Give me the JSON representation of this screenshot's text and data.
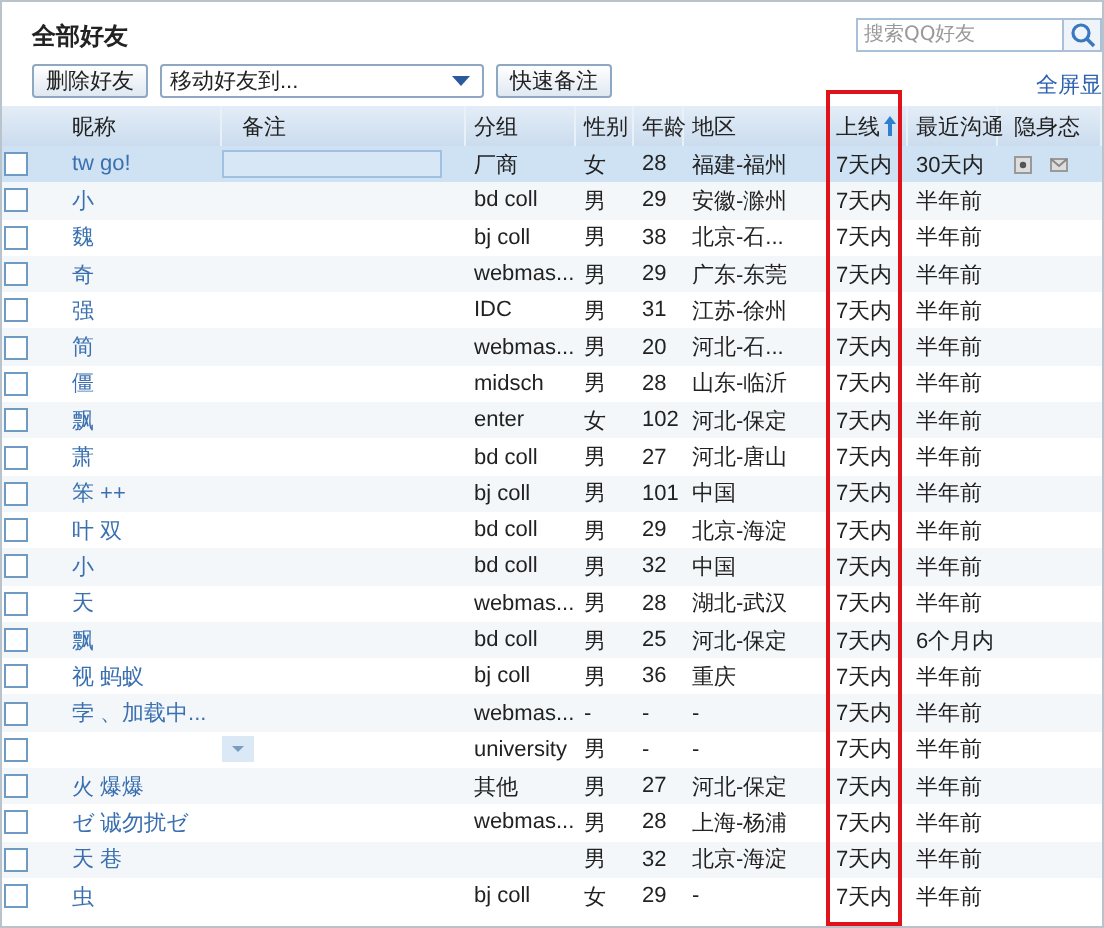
{
  "title": "全部好友",
  "toolbar": {
    "delete_button": "删除好友",
    "move_select": "移动好友到...",
    "remark_button": "快速备注"
  },
  "search": {
    "placeholder": "搜索QQ好友"
  },
  "fullscreen_link": "全屏显",
  "table": {
    "columns": [
      {
        "label": "昵称"
      },
      {
        "label": "备注"
      },
      {
        "label": "分组"
      },
      {
        "label": "性别"
      },
      {
        "label": "年龄"
      },
      {
        "label": "地区"
      },
      {
        "label": "上线",
        "sorted": true,
        "highlighted": true
      },
      {
        "label": "最近沟通"
      },
      {
        "label": "隐身态"
      }
    ],
    "rows": [
      {
        "nickname": "tw go!",
        "group": "厂商",
        "gender": "女",
        "age": "28",
        "region": "福建-福州",
        "online": "7天内",
        "recent": "30天内",
        "selected": true,
        "checked": false
      },
      {
        "nickname": "小",
        "group": "bd coll",
        "gender": "男",
        "age": "29",
        "region": "安徽-滁州",
        "online": "7天内",
        "recent": "半年前",
        "selected": false,
        "checked": false
      },
      {
        "nickname": "魏",
        "group": "bj coll",
        "gender": "男",
        "age": "38",
        "region": "北京-石...",
        "online": "7天内",
        "recent": "半年前",
        "selected": false,
        "checked": false
      },
      {
        "nickname": "奇",
        "group": "webmas...",
        "gender": "男",
        "age": "29",
        "region": "广东-东莞",
        "online": "7天内",
        "recent": "半年前",
        "selected": false,
        "checked": false
      },
      {
        "nickname": "强",
        "group": "IDC",
        "gender": "男",
        "age": "31",
        "region": "江苏-徐州",
        "online": "7天内",
        "recent": "半年前",
        "selected": false,
        "checked": false
      },
      {
        "nickname": "简",
        "group": "webmas...",
        "gender": "男",
        "age": "20",
        "region": "河北-石...",
        "online": "7天内",
        "recent": "半年前",
        "selected": false,
        "checked": false
      },
      {
        "nickname": "僵",
        "group": "midsch",
        "gender": "男",
        "age": "28",
        "region": "山东-临沂",
        "online": "7天内",
        "recent": "半年前",
        "selected": false,
        "checked": false
      },
      {
        "nickname": "飘",
        "group": "enter",
        "gender": "女",
        "age": "102",
        "region": "河北-保定",
        "online": "7天内",
        "recent": "半年前",
        "selected": false,
        "checked": false
      },
      {
        "nickname": "萧",
        "group": "bd coll",
        "gender": "男",
        "age": "27",
        "region": "河北-唐山",
        "online": "7天内",
        "recent": "半年前",
        "selected": false,
        "checked": false
      },
      {
        "nickname": "笨 ++",
        "group": "bj coll",
        "gender": "男",
        "age": "101",
        "region": "中国",
        "online": "7天内",
        "recent": "半年前",
        "selected": false,
        "checked": false
      },
      {
        "nickname": "叶 双",
        "group": "bd coll",
        "gender": "男",
        "age": "29",
        "region": "北京-海淀",
        "online": "7天内",
        "recent": "半年前",
        "selected": false,
        "checked": false
      },
      {
        "nickname": "小",
        "group": "bd coll",
        "gender": "男",
        "age": "32",
        "region": "中国",
        "online": "7天内",
        "recent": "半年前",
        "selected": false,
        "checked": false
      },
      {
        "nickname": "天",
        "group": "webmas...",
        "gender": "男",
        "age": "28",
        "region": "湖北-武汉",
        "online": "7天内",
        "recent": "半年前",
        "selected": false,
        "checked": false
      },
      {
        "nickname": "飘",
        "group": "bd coll",
        "gender": "男",
        "age": "25",
        "region": "河北-保定",
        "online": "7天内",
        "recent": "6个月内",
        "selected": false,
        "checked": false
      },
      {
        "nickname": "视 蚂蚁",
        "group": "bj coll",
        "gender": "男",
        "age": "36",
        "region": "重庆",
        "online": "7天内",
        "recent": "半年前",
        "selected": false,
        "checked": false
      },
      {
        "nickname": "孛 、加载中...",
        "group": "webmas...",
        "gender": "-",
        "age": "-",
        "region": "-",
        "online": "7天内",
        "recent": "半年前",
        "selected": false,
        "checked": false
      },
      {
        "group": "university",
        "gender": "男",
        "age": "-",
        "region": "-",
        "online": "7天内",
        "recent": "半年前",
        "selected": false,
        "checked": false,
        "remark_dropdown": true
      },
      {
        "nickname": "火 爆爆",
        "group": "其他",
        "gender": "男",
        "age": "27",
        "region": "河北-保定",
        "online": "7天内",
        "recent": "半年前",
        "selected": false,
        "checked": false
      },
      {
        "nickname": "ゼ 诚勿扰ゼ",
        "group": "webmas...",
        "gender": "男",
        "age": "28",
        "region": "上海-杨浦",
        "online": "7天内",
        "recent": "半年前",
        "selected": false,
        "checked": false
      },
      {
        "nickname": "天 巷",
        "gender": "男",
        "age": "32",
        "region": "北京-海淀",
        "online": "7天内",
        "recent": "半年前",
        "selected": false,
        "checked": false
      },
      {
        "nickname": "虫",
        "group": "bj coll",
        "gender": "女",
        "age": "29",
        "region": "-",
        "online": "7天内",
        "recent": "半年前",
        "selected": false,
        "checked": false
      }
    ]
  }
}
